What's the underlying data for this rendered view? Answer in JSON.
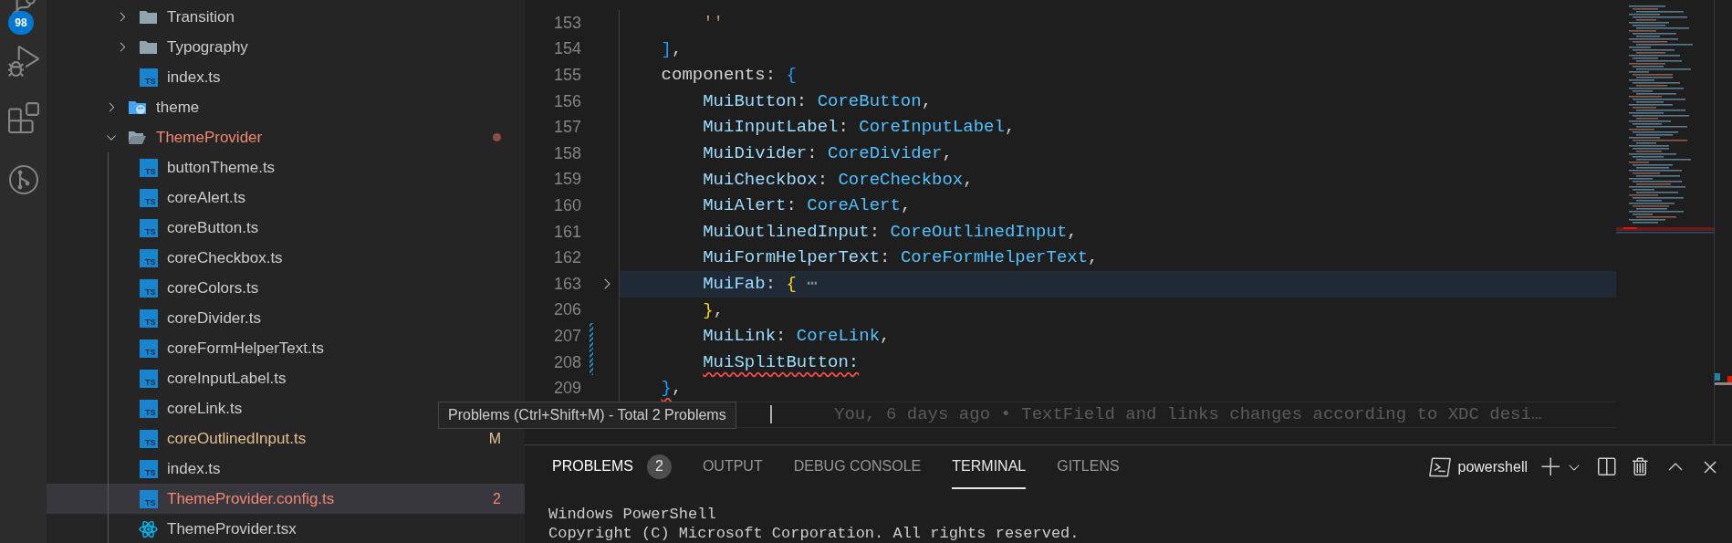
{
  "activity_bar": {
    "badge": "98"
  },
  "explorer": {
    "items": [
      {
        "kind": "continued",
        "children": [
          {
            "name": "Transition",
            "kind": "folder",
            "expanded": false,
            "problems": false,
            "color": "#cccccc",
            "selected": false
          },
          {
            "name": "Typography",
            "kind": "folder",
            "expanded": false,
            "problems": false,
            "color": "#cccccc",
            "selected": false
          },
          {
            "name": "index.ts",
            "kind": "ts",
            "icon_label": "TS",
            "color": "#cccccc",
            "selected": false
          }
        ]
      },
      {
        "name": "theme",
        "kind": "theme-folder",
        "expanded": false,
        "problems": false,
        "color": "#cccccc",
        "selected": false
      },
      {
        "name": "ThemeProvider",
        "kind": "folder",
        "expanded": true,
        "problems": true,
        "color": "#f48771",
        "selected": false,
        "children": [
          {
            "name": "buttonTheme.ts",
            "kind": "ts",
            "icon_label": "TS",
            "color": "#cccccc",
            "selected": false
          },
          {
            "name": "coreAlert.ts",
            "kind": "ts",
            "icon_label": "TS",
            "color": "#cccccc",
            "selected": false
          },
          {
            "name": "coreButton.ts",
            "kind": "ts",
            "icon_label": "TS",
            "color": "#cccccc",
            "selected": false
          },
          {
            "name": "coreCheckbox.ts",
            "kind": "ts",
            "icon_label": "TS",
            "color": "#cccccc",
            "selected": false
          },
          {
            "name": "coreColors.ts",
            "kind": "ts",
            "icon_label": "TS",
            "color": "#cccccc",
            "selected": false
          },
          {
            "name": "coreDivider.ts",
            "kind": "ts",
            "icon_label": "TS",
            "color": "#cccccc",
            "selected": false
          },
          {
            "name": "coreFormHelperText.ts",
            "kind": "ts",
            "icon_label": "TS",
            "color": "#cccccc",
            "selected": false
          },
          {
            "name": "coreInputLabel.ts",
            "kind": "ts",
            "icon_label": "TS",
            "color": "#cccccc",
            "selected": false
          },
          {
            "name": "coreLink.ts",
            "kind": "ts",
            "icon_label": "TS",
            "color": "#cccccc",
            "selected": false
          },
          {
            "name": "coreOutlinedInput.ts",
            "kind": "ts",
            "icon_label": "TS",
            "color": "#e2c08d",
            "decoration": "M",
            "selected": false
          },
          {
            "name": "index.ts",
            "kind": "ts",
            "icon_label": "TS",
            "color": "#cccccc",
            "selected": false
          },
          {
            "name": "ThemeProvider.config.ts",
            "kind": "ts",
            "icon_label": "TS",
            "color": "#f48771",
            "decoration": "2",
            "selected": true
          },
          {
            "name": "ThemeProvider.tsx",
            "kind": "react",
            "color": "#cccccc",
            "selected": false
          }
        ]
      }
    ]
  },
  "editor": {
    "lines": [
      {
        "number": "153",
        "folded": false,
        "modified": false,
        "highlighted": false,
        "tokens": [
          {
            "text": "        ''",
            "kind": "string",
            "error": false
          }
        ]
      },
      {
        "number": "154",
        "folded": false,
        "modified": false,
        "highlighted": false,
        "tokens": [
          {
            "text": "    ]",
            "kind": "bracket-blue",
            "error": false
          },
          {
            "text": ",",
            "kind": "punct",
            "error": false
          }
        ]
      },
      {
        "number": "155",
        "folded": false,
        "modified": false,
        "highlighted": false,
        "tokens": [
          {
            "text": "    components",
            "kind": "key",
            "error": false
          },
          {
            "text": ": ",
            "kind": "punct",
            "error": false
          },
          {
            "text": "{",
            "kind": "bracket-blue",
            "error": false
          }
        ]
      },
      {
        "number": "156",
        "folded": false,
        "modified": false,
        "highlighted": false,
        "tokens": [
          {
            "text": "        MuiButton",
            "kind": "property",
            "error": false
          },
          {
            "text": ": ",
            "kind": "punct",
            "error": false
          },
          {
            "text": "CoreButton",
            "kind": "value",
            "error": false
          },
          {
            "text": ",",
            "kind": "punct",
            "error": false
          }
        ]
      },
      {
        "number": "157",
        "folded": false,
        "modified": false,
        "highlighted": false,
        "tokens": [
          {
            "text": "        MuiInputLabel",
            "kind": "property",
            "error": false
          },
          {
            "text": ": ",
            "kind": "punct",
            "error": false
          },
          {
            "text": "CoreInputLabel",
            "kind": "value",
            "error": false
          },
          {
            "text": ",",
            "kind": "punct",
            "error": false
          }
        ]
      },
      {
        "number": "158",
        "folded": false,
        "modified": false,
        "highlighted": false,
        "tokens": [
          {
            "text": "        MuiDivider",
            "kind": "property",
            "error": false
          },
          {
            "text": ": ",
            "kind": "punct",
            "error": false
          },
          {
            "text": "CoreDivider",
            "kind": "value",
            "error": false
          },
          {
            "text": ",",
            "kind": "punct",
            "error": false
          }
        ]
      },
      {
        "number": "159",
        "folded": false,
        "modified": false,
        "highlighted": false,
        "tokens": [
          {
            "text": "        MuiCheckbox",
            "kind": "property",
            "error": false
          },
          {
            "text": ": ",
            "kind": "punct",
            "error": false
          },
          {
            "text": "CoreCheckbox",
            "kind": "value",
            "error": false
          },
          {
            "text": ",",
            "kind": "punct",
            "error": false
          }
        ]
      },
      {
        "number": "160",
        "folded": false,
        "modified": false,
        "highlighted": false,
        "tokens": [
          {
            "text": "        MuiAlert",
            "kind": "property",
            "error": false
          },
          {
            "text": ": ",
            "kind": "punct",
            "error": false
          },
          {
            "text": "CoreAlert",
            "kind": "value",
            "error": false
          },
          {
            "text": ",",
            "kind": "punct",
            "error": false
          }
        ]
      },
      {
        "number": "161",
        "folded": false,
        "modified": false,
        "highlighted": false,
        "tokens": [
          {
            "text": "        MuiOutlinedInput",
            "kind": "property",
            "error": false
          },
          {
            "text": ": ",
            "kind": "punct",
            "error": false
          },
          {
            "text": "CoreOutlinedInput",
            "kind": "value",
            "error": false
          },
          {
            "text": ",",
            "kind": "punct",
            "error": false
          }
        ]
      },
      {
        "number": "162",
        "folded": false,
        "modified": false,
        "highlighted": false,
        "tokens": [
          {
            "text": "        MuiFormHelperText",
            "kind": "property",
            "error": false
          },
          {
            "text": ": ",
            "kind": "punct",
            "error": false
          },
          {
            "text": "CoreFormHelperText",
            "kind": "value",
            "error": false
          },
          {
            "text": ",",
            "kind": "punct",
            "error": false
          }
        ]
      },
      {
        "number": "163",
        "folded": true,
        "modified": false,
        "highlighted": true,
        "tokens": [
          {
            "text": "        MuiFab",
            "kind": "property",
            "error": false
          },
          {
            "text": ": ",
            "kind": "punct",
            "error": false
          },
          {
            "text": "{",
            "kind": "bracket-yellow",
            "error": false
          },
          {
            "text": " ⋯",
            "kind": "ellipsis",
            "error": false
          }
        ]
      },
      {
        "number": "206",
        "folded": false,
        "modified": false,
        "highlighted": false,
        "tokens": [
          {
            "text": "        }",
            "kind": "bracket-yellow",
            "error": false
          },
          {
            "text": ",",
            "kind": "punct",
            "error": false
          }
        ]
      },
      {
        "number": "207",
        "folded": false,
        "modified": true,
        "highlighted": false,
        "tokens": [
          {
            "text": "        MuiLink",
            "kind": "property",
            "error": false
          },
          {
            "text": ": ",
            "kind": "punct",
            "error": false
          },
          {
            "text": "CoreLink",
            "kind": "value",
            "error": false
          },
          {
            "text": ",",
            "kind": "punct",
            "error": false
          }
        ]
      },
      {
        "number": "208",
        "folded": false,
        "modified": true,
        "highlighted": false,
        "tokens": [
          {
            "text": "        MuiSplitButton:",
            "kind": "property",
            "error": true
          }
        ]
      },
      {
        "number": "209",
        "folded": false,
        "modified": false,
        "highlighted": false,
        "tokens": [
          {
            "text": "    }",
            "kind": "bracket-blue",
            "error": true
          },
          {
            "text": ",",
            "kind": "punct",
            "error": false
          }
        ]
      }
    ],
    "blame": "You, 6 days ago • TextField and links changes according to XDC desi…"
  },
  "tooltip": "Problems (Ctrl+Shift+M) - Total 2 Problems",
  "panel": {
    "tabs": [
      {
        "label": "PROBLEMS",
        "count": "2",
        "selected": false,
        "hovered": true
      },
      {
        "label": "OUTPUT",
        "selected": false,
        "hovered": false
      },
      {
        "label": "DEBUG CONSOLE",
        "selected": false,
        "hovered": false
      },
      {
        "label": "TERMINAL",
        "selected": true,
        "hovered": false
      },
      {
        "label": "GITLENS",
        "selected": false,
        "hovered": false
      }
    ],
    "terminal_name": "powershell",
    "terminal_lines": [
      "Windows PowerShell",
      "Copyright (C) Microsoft Corporation. All rights reserved."
    ]
  }
}
